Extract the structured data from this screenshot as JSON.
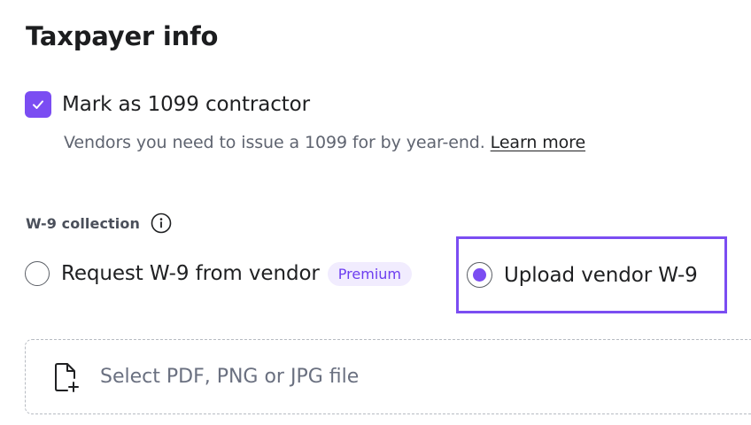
{
  "section": {
    "title": "Taxpayer info"
  },
  "contractor": {
    "checked": true,
    "label": "Mark as 1099 contractor",
    "helper_text": "Vendors you need to issue a 1099 for by year-end.",
    "learn_more": "Learn more"
  },
  "w9": {
    "label": "W-9 collection",
    "options": [
      {
        "label": "Request W-9 from vendor",
        "badge": "Premium",
        "selected": false
      },
      {
        "label": "Upload vendor W-9",
        "selected": true
      }
    ]
  },
  "upload": {
    "prompt": "Select PDF, PNG or JPG file"
  },
  "colors": {
    "accent": "#7b4df2",
    "badge_bg": "#f1ecfe",
    "muted_text": "#6a7080"
  },
  "icons": {
    "checkbox": "check-icon",
    "info": "info-icon",
    "file": "file-add-icon"
  }
}
